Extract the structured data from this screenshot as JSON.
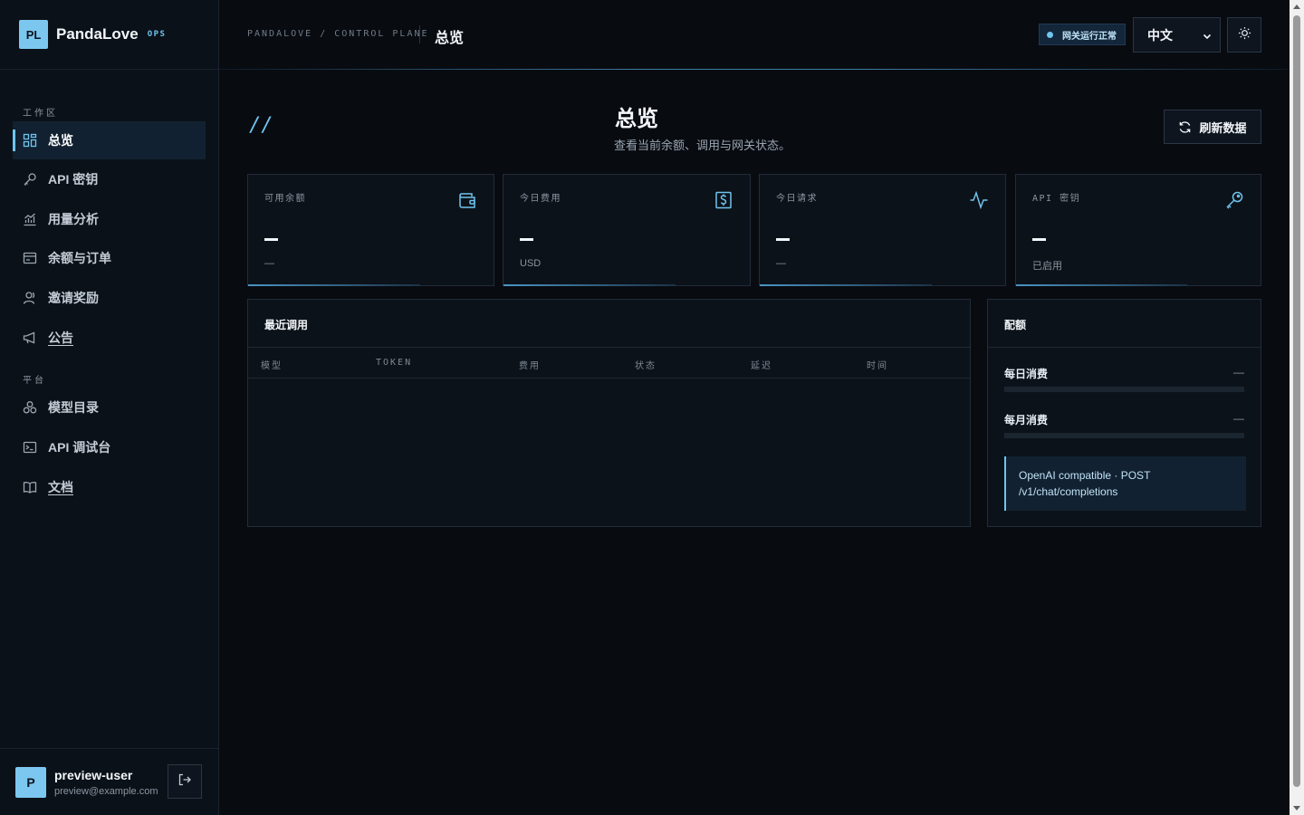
{
  "brand": {
    "logo": "PL",
    "name": "PandaLove",
    "tag": "OPS"
  },
  "sidebar": {
    "sections": [
      {
        "title": "工作区",
        "items": [
          {
            "label": "总览",
            "icon": "dashboard-icon",
            "active": true
          },
          {
            "label": "API 密钥",
            "icon": "key-icon"
          },
          {
            "label": "用量分析",
            "icon": "chart-icon"
          },
          {
            "label": "余额与订单",
            "icon": "wallet-icon"
          },
          {
            "label": "邀请奖励",
            "icon": "user-icon"
          },
          {
            "label": "公告",
            "icon": "megaphone-icon"
          }
        ]
      },
      {
        "title": "平台",
        "items": [
          {
            "label": "模型目录",
            "icon": "models-icon"
          },
          {
            "label": "API 调试台",
            "icon": "terminal-icon"
          },
          {
            "label": "文档",
            "icon": "book-icon"
          }
        ]
      }
    ]
  },
  "user": {
    "avatar": "P",
    "name": "preview-user",
    "email": "preview@example.com"
  },
  "header": {
    "breadcrumb": "PANDALOVE / CONTROL PLANE",
    "page": "总览",
    "status": "网关运行正常",
    "language": "中文"
  },
  "main": {
    "title": "总览",
    "subtitle": "查看当前余额、调用与网关状态。",
    "decor": "//",
    "refresh_label": "刷新数据"
  },
  "stats": [
    {
      "label": "可用余额",
      "value": "—",
      "sub": "—",
      "icon": "wallet-icon"
    },
    {
      "label": "今日费用",
      "value": "—",
      "sub": "USD",
      "icon": "dollar-icon"
    },
    {
      "label": "今日请求",
      "value": "—",
      "sub": "—",
      "icon": "activity-icon"
    },
    {
      "label": "API 密钥",
      "value": "—",
      "sub": "已启用",
      "icon": "key-icon"
    }
  ],
  "recent_calls": {
    "title": "最近调用",
    "columns": [
      "模型",
      "TOKEN",
      "费用",
      "状态",
      "延迟",
      "时间"
    ],
    "rows": []
  },
  "quota": {
    "title": "配额",
    "daily_label": "每日消费",
    "daily_value": "—",
    "daily_fraction": 0,
    "monthly_label": "每月消费",
    "monthly_value": "—",
    "monthly_fraction": 0,
    "endpoint_line1": "OpenAI compatible · POST",
    "endpoint_line2": "/v1/chat/completions"
  },
  "colors": {
    "accent": "#6ec4ef",
    "background": "#080b10",
    "panel": "#0c1219"
  }
}
